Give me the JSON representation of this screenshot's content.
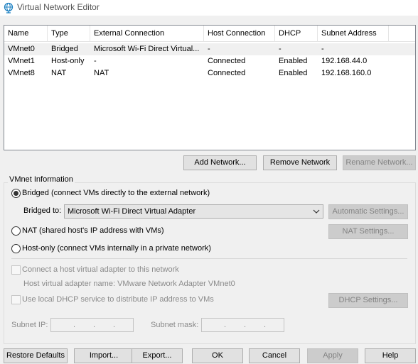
{
  "window": {
    "title": "Virtual Network Editor",
    "icon": "globe-network-icon"
  },
  "table": {
    "columns": [
      "Name",
      "Type",
      "External Connection",
      "Host Connection",
      "DHCP",
      "Subnet Address"
    ],
    "rows": [
      [
        "VMnet0",
        "Bridged",
        "Microsoft Wi-Fi Direct Virtual...",
        "-",
        "-",
        "-"
      ],
      [
        "VMnet1",
        "Host-only",
        "-",
        "Connected",
        "Enabled",
        "192.168.44.0"
      ],
      [
        "VMnet8",
        "NAT",
        "NAT",
        "Connected",
        "Enabled",
        "192.168.160.0"
      ]
    ],
    "selected_row": 0
  },
  "list_buttons": {
    "add": "Add Network...",
    "remove": "Remove Network",
    "rename": "Rename Network..."
  },
  "vmnet_info": {
    "group_label": "VMnet Information",
    "bridged_label": "Bridged (connect VMs directly to the external network)",
    "bridged_to_label": "Bridged to:",
    "bridged_to_value": "Microsoft Wi-Fi Direct Virtual Adapter",
    "automatic_settings": "Automatic Settings...",
    "nat_label": "NAT (shared host's IP address with VMs)",
    "nat_settings": "NAT Settings...",
    "hostonly_label": "Host-only (connect VMs internally in a private network)",
    "connect_adapter_label": "Connect a host virtual adapter to this network",
    "adapter_name_label": "Host virtual adapter name: VMware Network Adapter VMnet0",
    "dhcp_label": "Use local DHCP service to distribute IP address to VMs",
    "dhcp_settings": "DHCP Settings...",
    "subnet_ip_label": "Subnet IP:",
    "subnet_mask_label": "Subnet mask:",
    "selected_mode": "bridged"
  },
  "bottom_buttons": {
    "restore": "Restore Defaults",
    "import": "Import...",
    "export": "Export...",
    "ok": "OK",
    "cancel": "Cancel",
    "apply": "Apply",
    "help": "Help"
  }
}
